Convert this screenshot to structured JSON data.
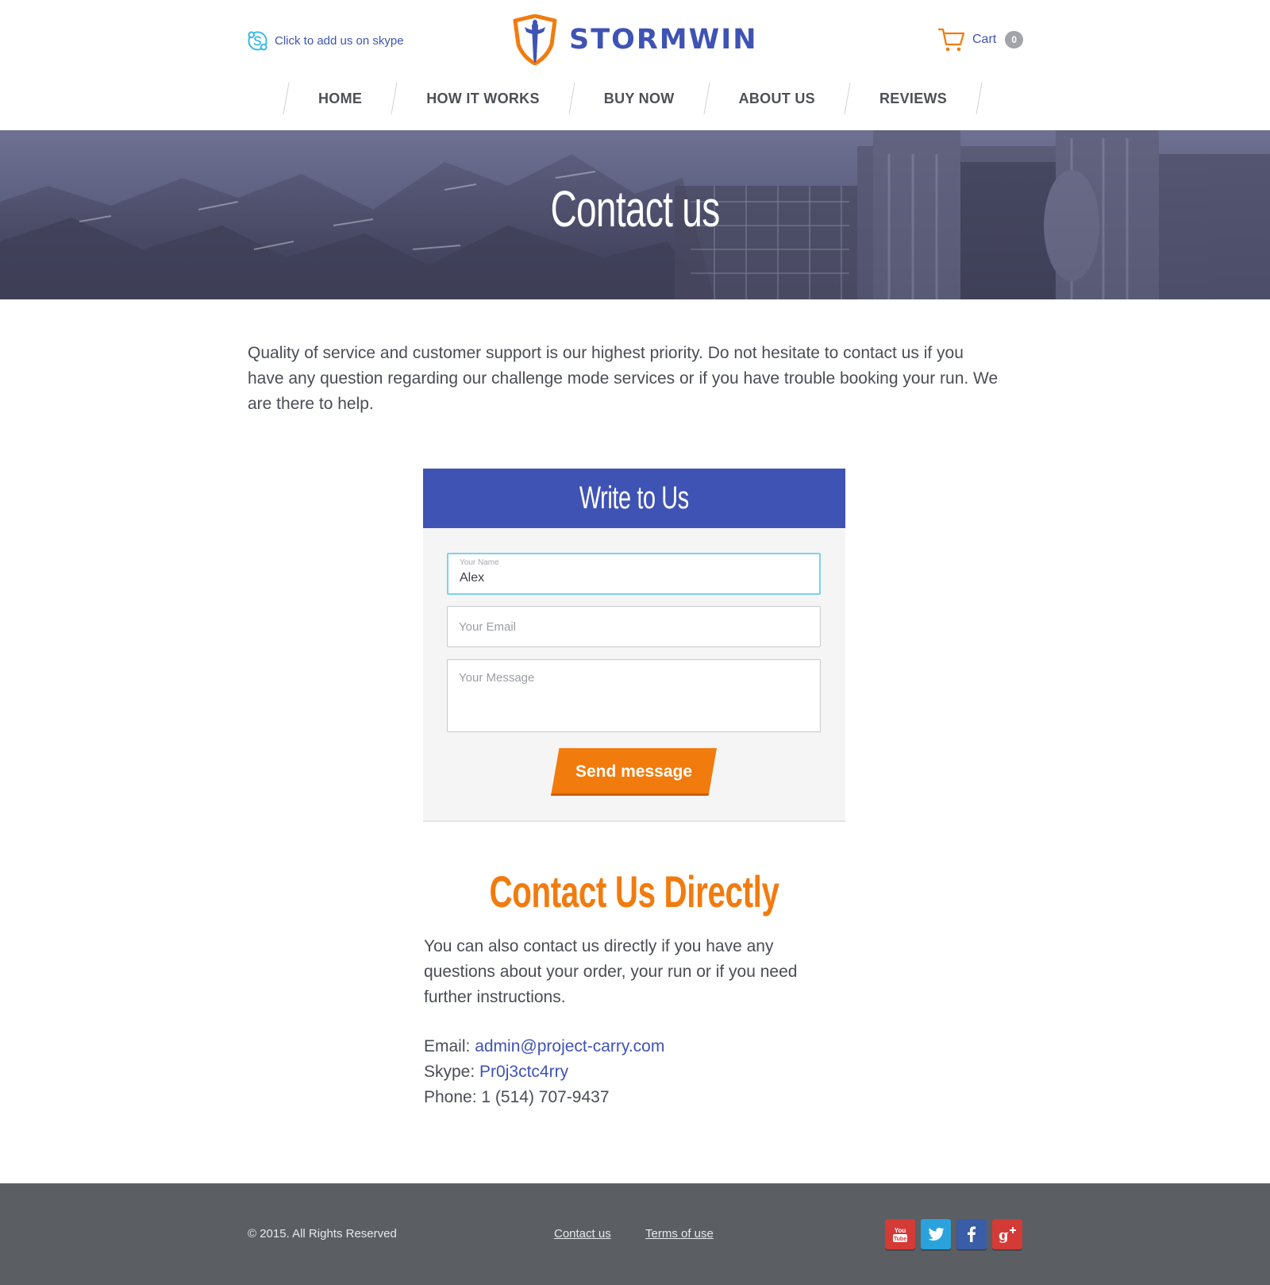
{
  "header": {
    "skype_link": "Click to add us on skype",
    "logo_text": "STORMWIN",
    "cart_label": "Cart",
    "cart_count": "0"
  },
  "nav": {
    "items": [
      "HOME",
      "HOW IT WORKS",
      "BUY NOW",
      "ABOUT US",
      "REVIEWS"
    ]
  },
  "hero": {
    "title": "Contact us"
  },
  "intro": "Quality of service and customer support is our highest priority. Do not hesitate to contact us if you have any question regarding our challenge mode services or if you have trouble booking your run. We are there to help.",
  "form": {
    "title": "Write to Us",
    "name_label": "Your Name",
    "name_value": "Alex",
    "email_placeholder": "Your Email",
    "message_placeholder": "Your Message",
    "send_label": "Send message"
  },
  "direct": {
    "title": "Contact Us Directly",
    "text": "You can also contact us directly if you have any questions about your order, your run or if you need further instructions.",
    "email_label": "Email:",
    "email_value": "admin@project-carry.com",
    "skype_label": "Skype:",
    "skype_value": "Pr0j3ctc4rry",
    "phone_label": "Phone:",
    "phone_value": "1 (514) 707-9437"
  },
  "footer": {
    "copyright": "© 2015. All Rights Reserved",
    "contact_link": "Contact us",
    "terms_link": "Terms of use",
    "social": [
      "youtube-icon",
      "twitter-icon",
      "facebook-icon",
      "google-plus-icon"
    ]
  },
  "colors": {
    "brand_blue": "#3f53b5",
    "accent_orange": "#f27b0e",
    "footer_bg": "#5b5e63",
    "focus_border": "#7cd2ee"
  }
}
